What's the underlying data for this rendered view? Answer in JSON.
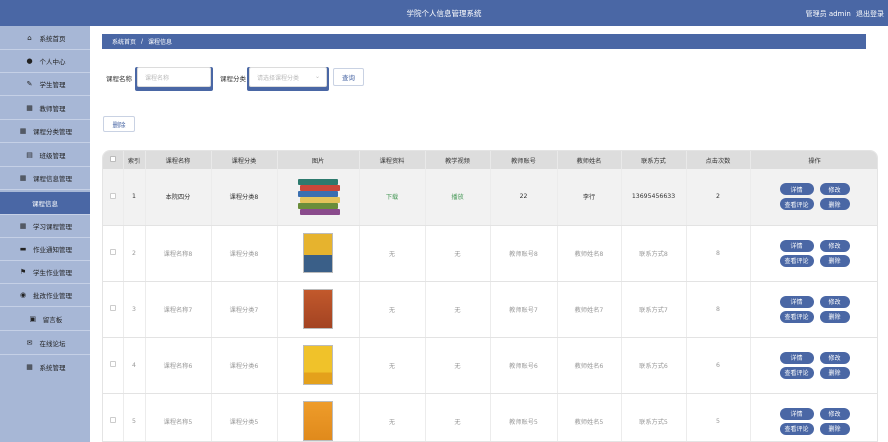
{
  "header": {
    "title": "学院个人信息管理系统",
    "user_label": "管理员 admin",
    "logout_label": "退出登录"
  },
  "sidebar": {
    "items": [
      {
        "label": "系统首页",
        "icon": "home-icon"
      },
      {
        "label": "个人中心",
        "icon": "user-icon"
      },
      {
        "label": "学生管理",
        "icon": "pin-icon"
      },
      {
        "label": "教师管理",
        "icon": "grid-icon"
      },
      {
        "label": "课程分类管理",
        "icon": "grid-icon"
      },
      {
        "label": "班级管理",
        "icon": "list-icon"
      },
      {
        "label": "课程信息管理",
        "icon": "grid-icon"
      },
      {
        "label": "课程信息",
        "icon": "",
        "active": true
      },
      {
        "label": "学习课程管理",
        "icon": "grid-icon"
      },
      {
        "label": "作业通知管理",
        "icon": "doc-icon"
      },
      {
        "label": "学生作业管理",
        "icon": "flag-icon"
      },
      {
        "label": "批改作业管理",
        "icon": "palette-icon"
      },
      {
        "label": "留言板",
        "icon": "board-icon"
      },
      {
        "label": "在线论坛",
        "icon": "chat-icon"
      },
      {
        "label": "系统管理",
        "icon": "grid-icon"
      }
    ]
  },
  "breadcrumb": {
    "home": "系统首页",
    "separator": "/",
    "current": "课程信息"
  },
  "search": {
    "name_label": "课程名称",
    "name_placeholder": "课程名称",
    "category_label": "课程分类",
    "category_placeholder": "请选择课程分类",
    "query_button": "查询"
  },
  "actions": {
    "delete_button": "删除"
  },
  "table": {
    "headers": [
      "",
      "索引",
      "课程名称",
      "课程分类",
      "图片",
      "课程资料",
      "教学视频",
      "教师账号",
      "教师姓名",
      "联系方式",
      "点击次数",
      "操作"
    ],
    "rows": [
      {
        "index": "1",
        "name": "本院四分",
        "category": "课程分类8",
        "image": "books-stack",
        "material": "下载",
        "video": "播放",
        "teacher_account": "22",
        "teacher_name": "李行",
        "contact": "13695456633",
        "clicks": "2"
      },
      {
        "index": "2",
        "name": "课程名称8",
        "category": "课程分类8",
        "image": "book-yellow-city",
        "material": "无",
        "video": "无",
        "teacher_account": "教师账号8",
        "teacher_name": "教师姓名8",
        "contact": "联系方式8",
        "clicks": "8"
      },
      {
        "index": "3",
        "name": "课程名称7",
        "category": "课程分类7",
        "image": "book-orange",
        "material": "无",
        "video": "无",
        "teacher_account": "教师账号7",
        "teacher_name": "教师姓名7",
        "contact": "联系方式7",
        "clicks": "8"
      },
      {
        "index": "4",
        "name": "课程名称6",
        "category": "课程分类6",
        "image": "book-yellow",
        "material": "无",
        "video": "无",
        "teacher_account": "教师账号6",
        "teacher_name": "教师姓名6",
        "contact": "联系方式6",
        "clicks": "6"
      },
      {
        "index": "5",
        "name": "课程名称5",
        "category": "课程分类5",
        "image": "book-orange-2",
        "material": "无",
        "video": "无",
        "teacher_account": "教师账号5",
        "teacher_name": "教师姓名5",
        "contact": "联系方式5",
        "clicks": "5"
      }
    ],
    "op_labels": {
      "detail": "详情",
      "edit": "修改",
      "comments": "查看评论",
      "delete": "删除"
    }
  },
  "colors": {
    "primary": "#4a67a5",
    "sidebar_bg": "#a7b7d6"
  }
}
